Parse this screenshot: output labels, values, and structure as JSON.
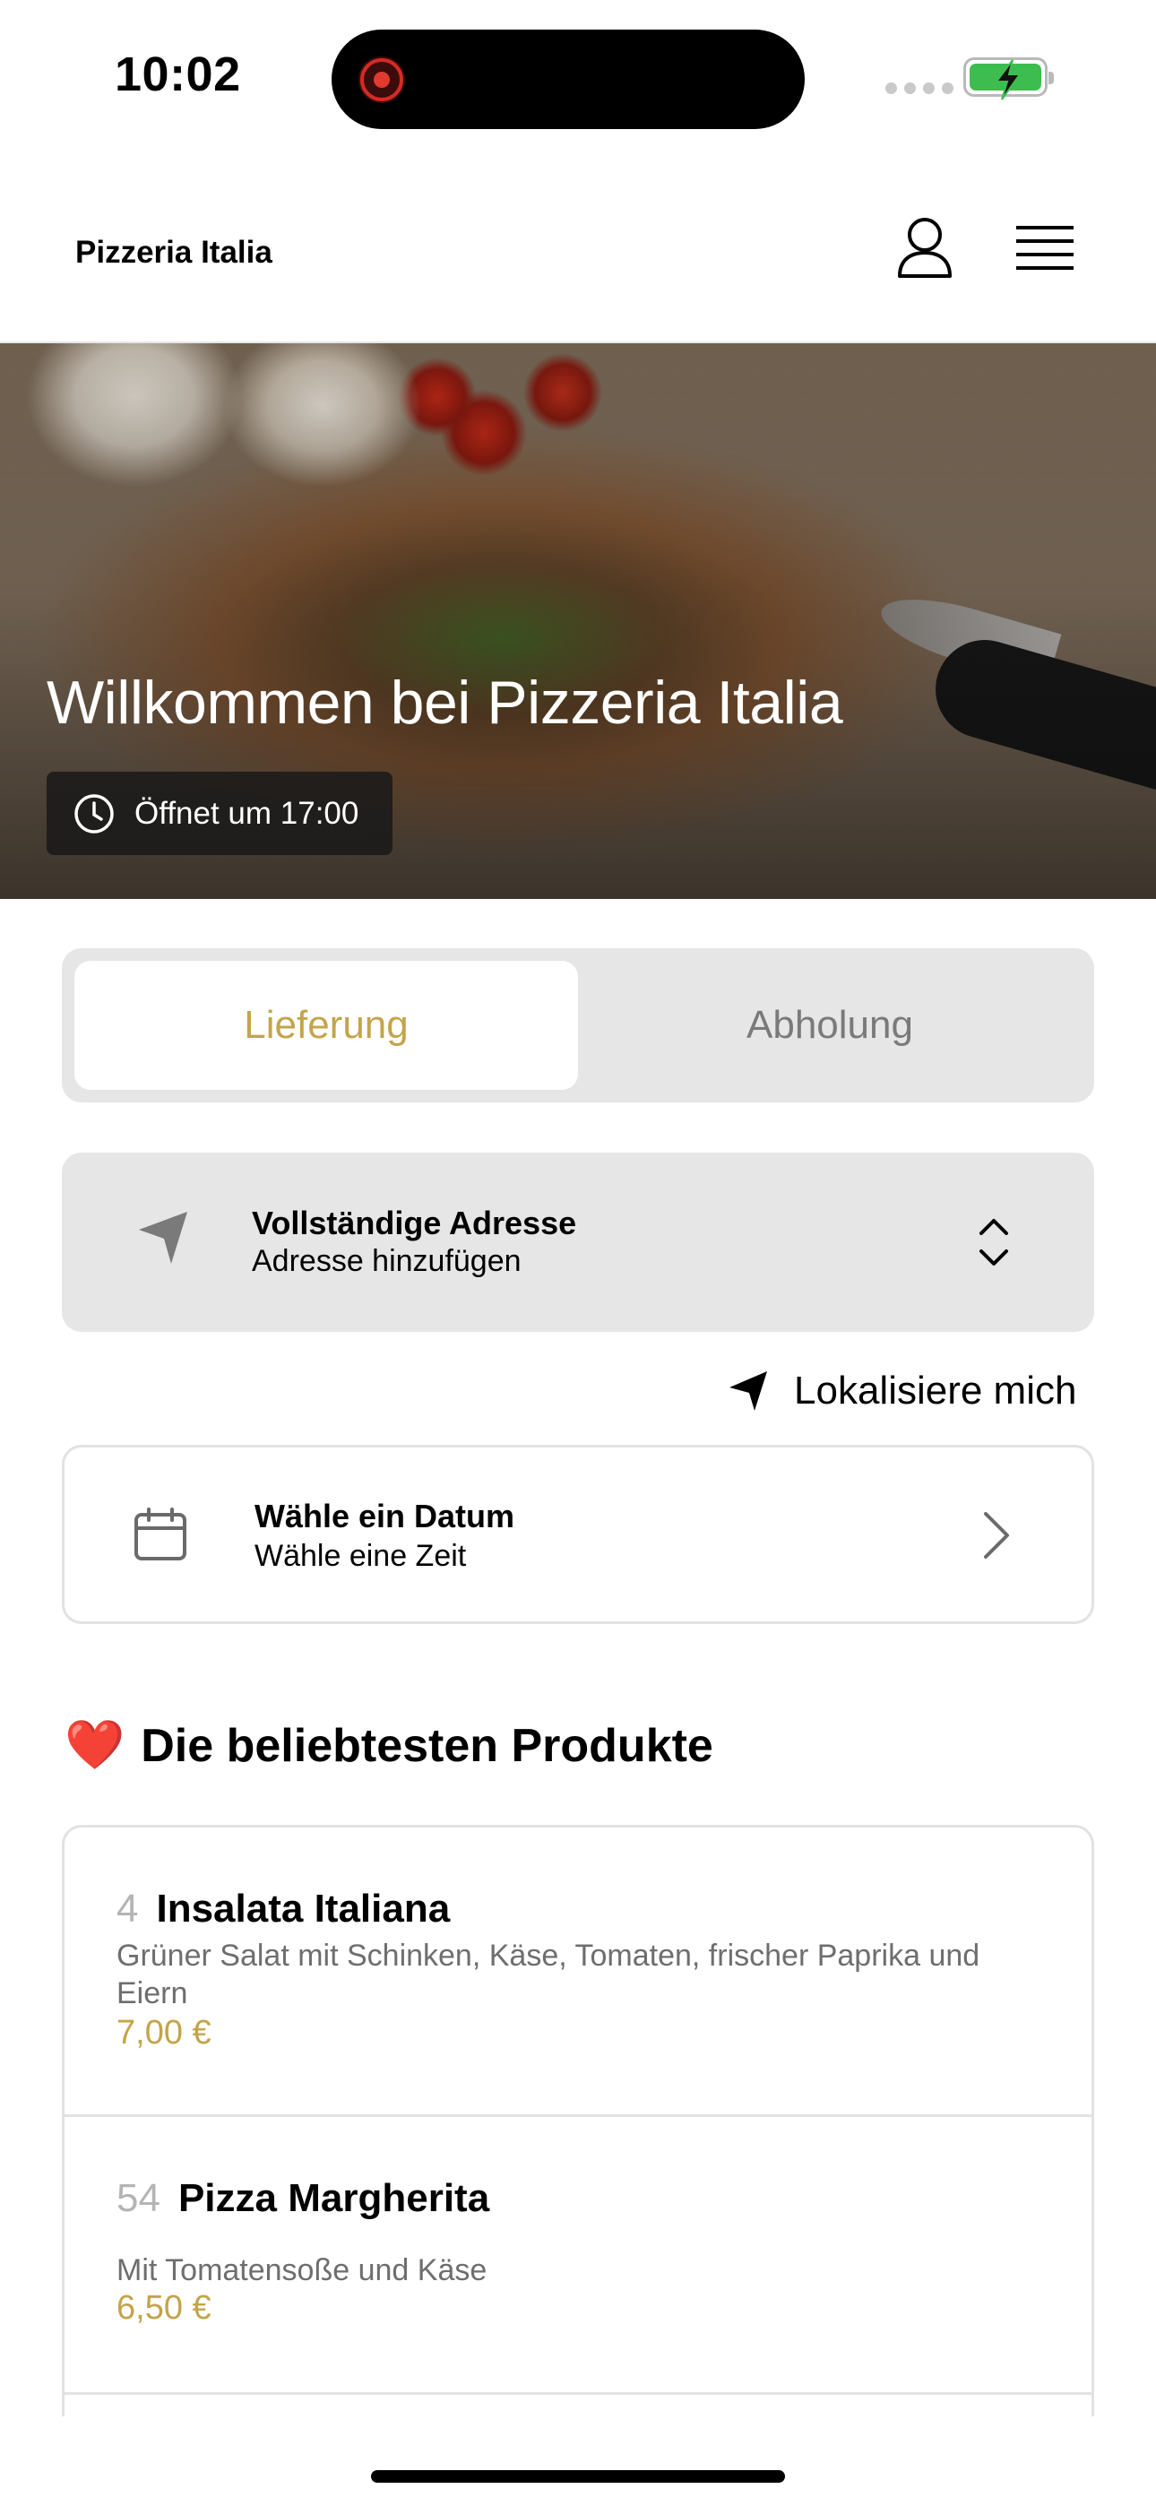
{
  "status_bar": {
    "time": "10:02"
  },
  "header": {
    "brand": "Pizzeria Italia",
    "icons": [
      "user-icon",
      "menu-icon"
    ]
  },
  "hero": {
    "title": "Willkommen bei Pizzeria Italia",
    "opening_hours": "Öffnet um 17:00"
  },
  "order_mode": {
    "tabs": [
      {
        "label": "Lieferung",
        "active": true
      },
      {
        "label": "Abholung",
        "active": false
      }
    ]
  },
  "address": {
    "title": "Vollständige Adresse",
    "subtitle": "Adresse hinzufügen"
  },
  "locate": {
    "label": "Lokalisiere mich"
  },
  "schedule": {
    "title": "Wähle ein Datum",
    "subtitle": "Wähle eine Zeit"
  },
  "popular": {
    "title": "Die beliebtesten Produkte",
    "emoji": "❤️",
    "items": [
      {
        "number": "4",
        "name": "Insalata Italiana",
        "description": "Grüner Salat mit Schinken, Käse, Tomaten, frischer Paprika und Eiern",
        "price": "7,00 €"
      },
      {
        "number": "54",
        "name": "Pizza Margherita",
        "description": "Mit Tomatensoße und Käse",
        "price": "6,50 €"
      }
    ]
  },
  "colors": {
    "accent": "#c4a44a",
    "card_bg": "#e6e6e6",
    "muted_text": "#6e6e6e"
  }
}
